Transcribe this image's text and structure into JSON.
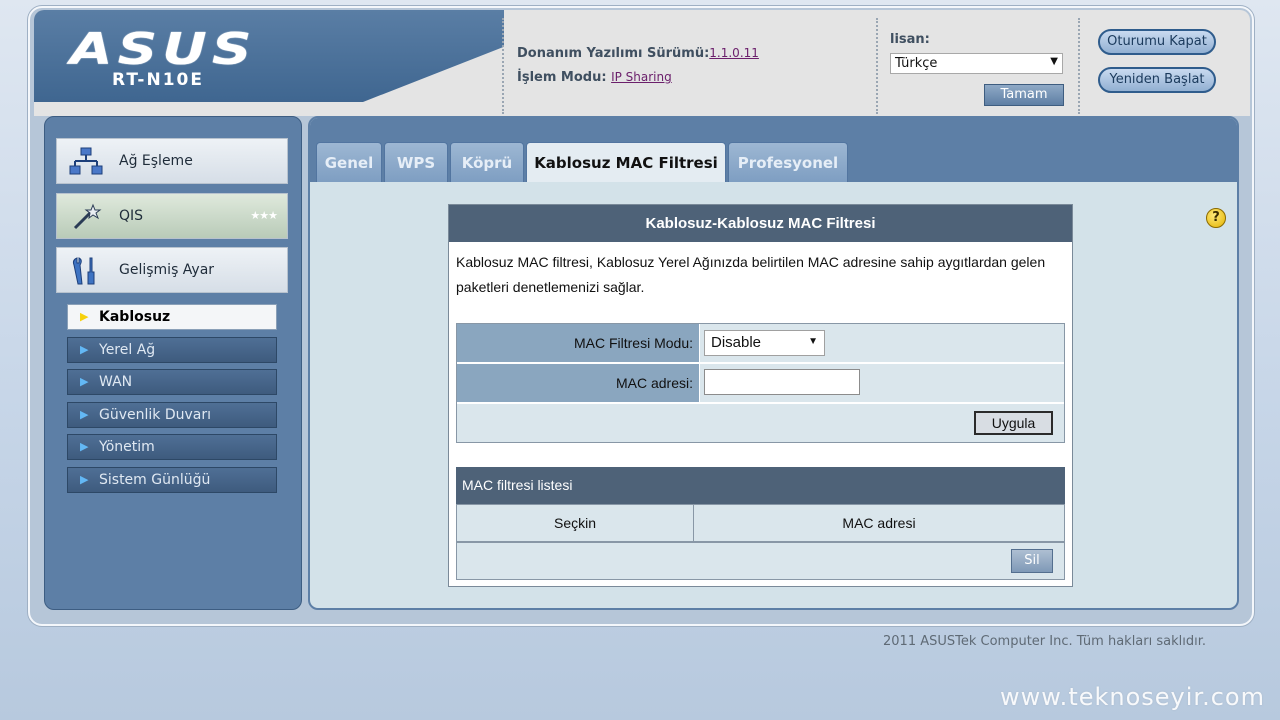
{
  "header": {
    "logo_text": "ASUS",
    "model": "RT-N10E",
    "firmware_label": "Donanım Yazılımı Sürümü:",
    "firmware_version": "1.1.0.11",
    "mode_label": "İşlem Modu:",
    "mode_value": "IP Sharing",
    "language_label": "lisan:",
    "language_value": "Türkçe",
    "ok_button": "Tamam",
    "logout_button": "Oturumu Kapat",
    "restart_button": "Yeniden Başlat"
  },
  "sidebar": {
    "main_items": [
      {
        "label": "Ağ Eşleme",
        "icon": "network-map-icon"
      },
      {
        "label": "QIS",
        "icon": "magic-wand-icon"
      },
      {
        "label": "Gelişmiş Ayar",
        "icon": "tools-icon"
      }
    ],
    "sub_items": [
      {
        "label": "Kablosuz",
        "active": true
      },
      {
        "label": "Yerel Ağ",
        "active": false
      },
      {
        "label": "WAN",
        "active": false
      },
      {
        "label": "Güvenlik Duvarı",
        "active": false
      },
      {
        "label": "Yönetim",
        "active": false
      },
      {
        "label": "Sistem Günlüğü",
        "active": false
      }
    ]
  },
  "tabs": [
    {
      "label": "Genel",
      "active": false
    },
    {
      "label": "WPS",
      "active": false
    },
    {
      "label": "Köprü",
      "active": false
    },
    {
      "label": "Kablosuz MAC Filtresi",
      "active": true
    },
    {
      "label": "Profesyonel",
      "active": false
    }
  ],
  "content": {
    "title": "Kablosuz-Kablosuz MAC Filtresi",
    "description": "Kablosuz MAC filtresi, Kablosuz Yerel Ağınızda belirtilen MAC adresine sahip aygıtlardan gelen paketleri denetlemenizi sağlar.",
    "mode_label": "MAC Filtresi Modu:",
    "mode_value": "Disable",
    "address_label": "MAC adresi:",
    "address_value": "",
    "apply_button": "Uygula",
    "list_title": "MAC filtresi listesi",
    "list_columns": [
      "Seçkin",
      "MAC adresi"
    ],
    "delete_button": "Sil"
  },
  "footer": {
    "copyright": "2011 ASUSTek Computer Inc. Tüm hakları saklıdır.",
    "watermark": "www.teknoseyir.com"
  }
}
